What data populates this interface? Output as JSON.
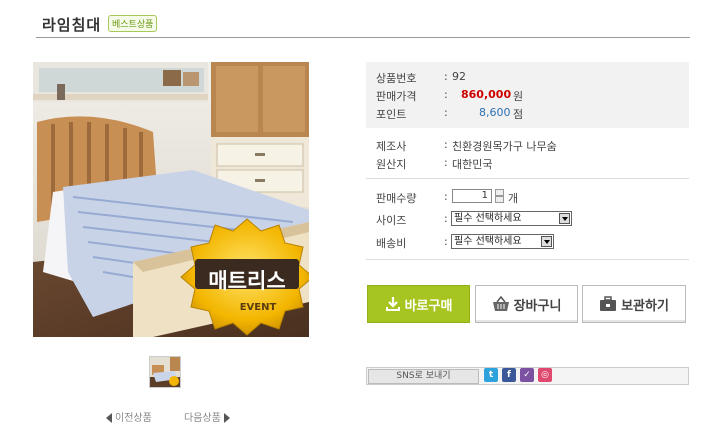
{
  "product": {
    "title": "라임침대",
    "badge": "베스트상품"
  },
  "info": {
    "product_no_label": "상품번호",
    "product_no_value": "92",
    "price_label": "판매가격",
    "price_value": "860,000",
    "price_unit": "원",
    "point_label": "포인트",
    "point_value": "8,600",
    "point_unit": "점",
    "maker_label": "제조사",
    "maker_value": "친환경원목가구 나무숨",
    "origin_label": "원산지",
    "origin_value": "대한민국",
    "qty_label": "판매수량",
    "qty_value": "1",
    "qty_unit": "개",
    "size_label": "사이즈",
    "size_selected": "필수 선택하세요",
    "shipping_label": "배송비",
    "shipping_selected": "필수 선택하세요",
    "colon": ":"
  },
  "image_badge": {
    "main": "매트리스",
    "sub": "EVENT"
  },
  "nav": {
    "prev": "이전상품",
    "next": "다음상품"
  },
  "buttons": {
    "buy": "바로구매",
    "cart": "장바구니",
    "wish": "보관하기"
  },
  "sns": {
    "label": "SNS로 보내기",
    "icons": [
      "t",
      "f",
      "✓",
      "◎"
    ]
  },
  "colors": {
    "accent_green": "#a7c521",
    "price_red": "#cc0000",
    "point_blue": "#2d6fb0"
  }
}
